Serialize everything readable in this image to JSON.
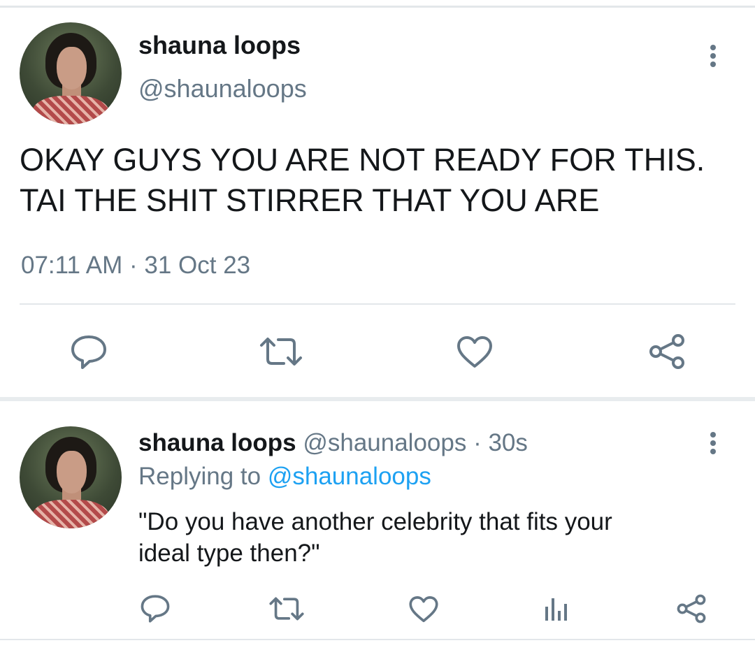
{
  "main_tweet": {
    "author_name": "shauna loops",
    "author_handle": "@shaunaloops",
    "text_line1": "OKAY GUYS YOU ARE NOT READY FOR THIS.",
    "text_line2": "TAI THE SHIT STIRRER THAT YOU ARE",
    "timestamp": "07:11 AM · 31 Oct 23",
    "actions": [
      "reply-icon",
      "retweet-icon",
      "like-icon",
      "share-icon"
    ]
  },
  "reply_tweet": {
    "author_name": "shauna loops",
    "author_handle": "@shaunaloops",
    "separator": " · ",
    "age": "30s",
    "replying_prefix": "Replying to ",
    "replying_to": "@shaunaloops",
    "text_line1": "\"Do you have another celebrity that fits your",
    "text_line2": "ideal type then?\"",
    "actions": [
      "reply-icon",
      "retweet-icon",
      "like-icon",
      "analytics-icon",
      "share-icon"
    ]
  },
  "colors": {
    "primary_text": "#14171a",
    "secondary_text": "#657786",
    "link": "#1da1f2",
    "divider": "#e3e7ea"
  }
}
